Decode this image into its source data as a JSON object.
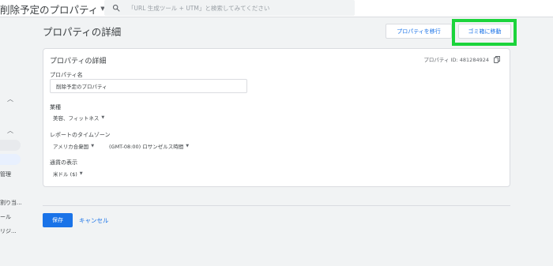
{
  "header": {
    "property_name": "削除予定のプロパティ",
    "search_placeholder": "「URL 生成ツール + UTM」と検索してみてください"
  },
  "sidebar": {
    "items": [
      "管理",
      "割り当...",
      "ール",
      "リジ..."
    ]
  },
  "page": {
    "title": "プロパティの詳細",
    "move_property_button": "プロパティを移行",
    "move_to_trash_button": "ゴミ箱に移動"
  },
  "card": {
    "title": "プロパティの詳細",
    "property_id": "プロパティ ID: 481284924",
    "name_label": "プロパティ名",
    "name_value": "削除予定のプロパティ",
    "industry_label": "業種",
    "industry_value": "美容、フィットネス",
    "timezone_label": "レポートのタイムゾーン",
    "timezone_country": "アメリカ合衆国",
    "timezone_value": "(GMT-08:00) ロサンゼルス時間",
    "currency_label": "通貨の表示",
    "currency_value": "米ドル ($)"
  },
  "footer": {
    "save_button": "保存",
    "cancel_button": "キャンセル"
  },
  "colors": {
    "accent": "#1a73e8",
    "highlight": "#1bd43b",
    "nav_selected": "#e8f0fe"
  },
  "icons": [
    "search-icon",
    "copy-icon",
    "chevron-up-icon",
    "caret-down-icon"
  ]
}
